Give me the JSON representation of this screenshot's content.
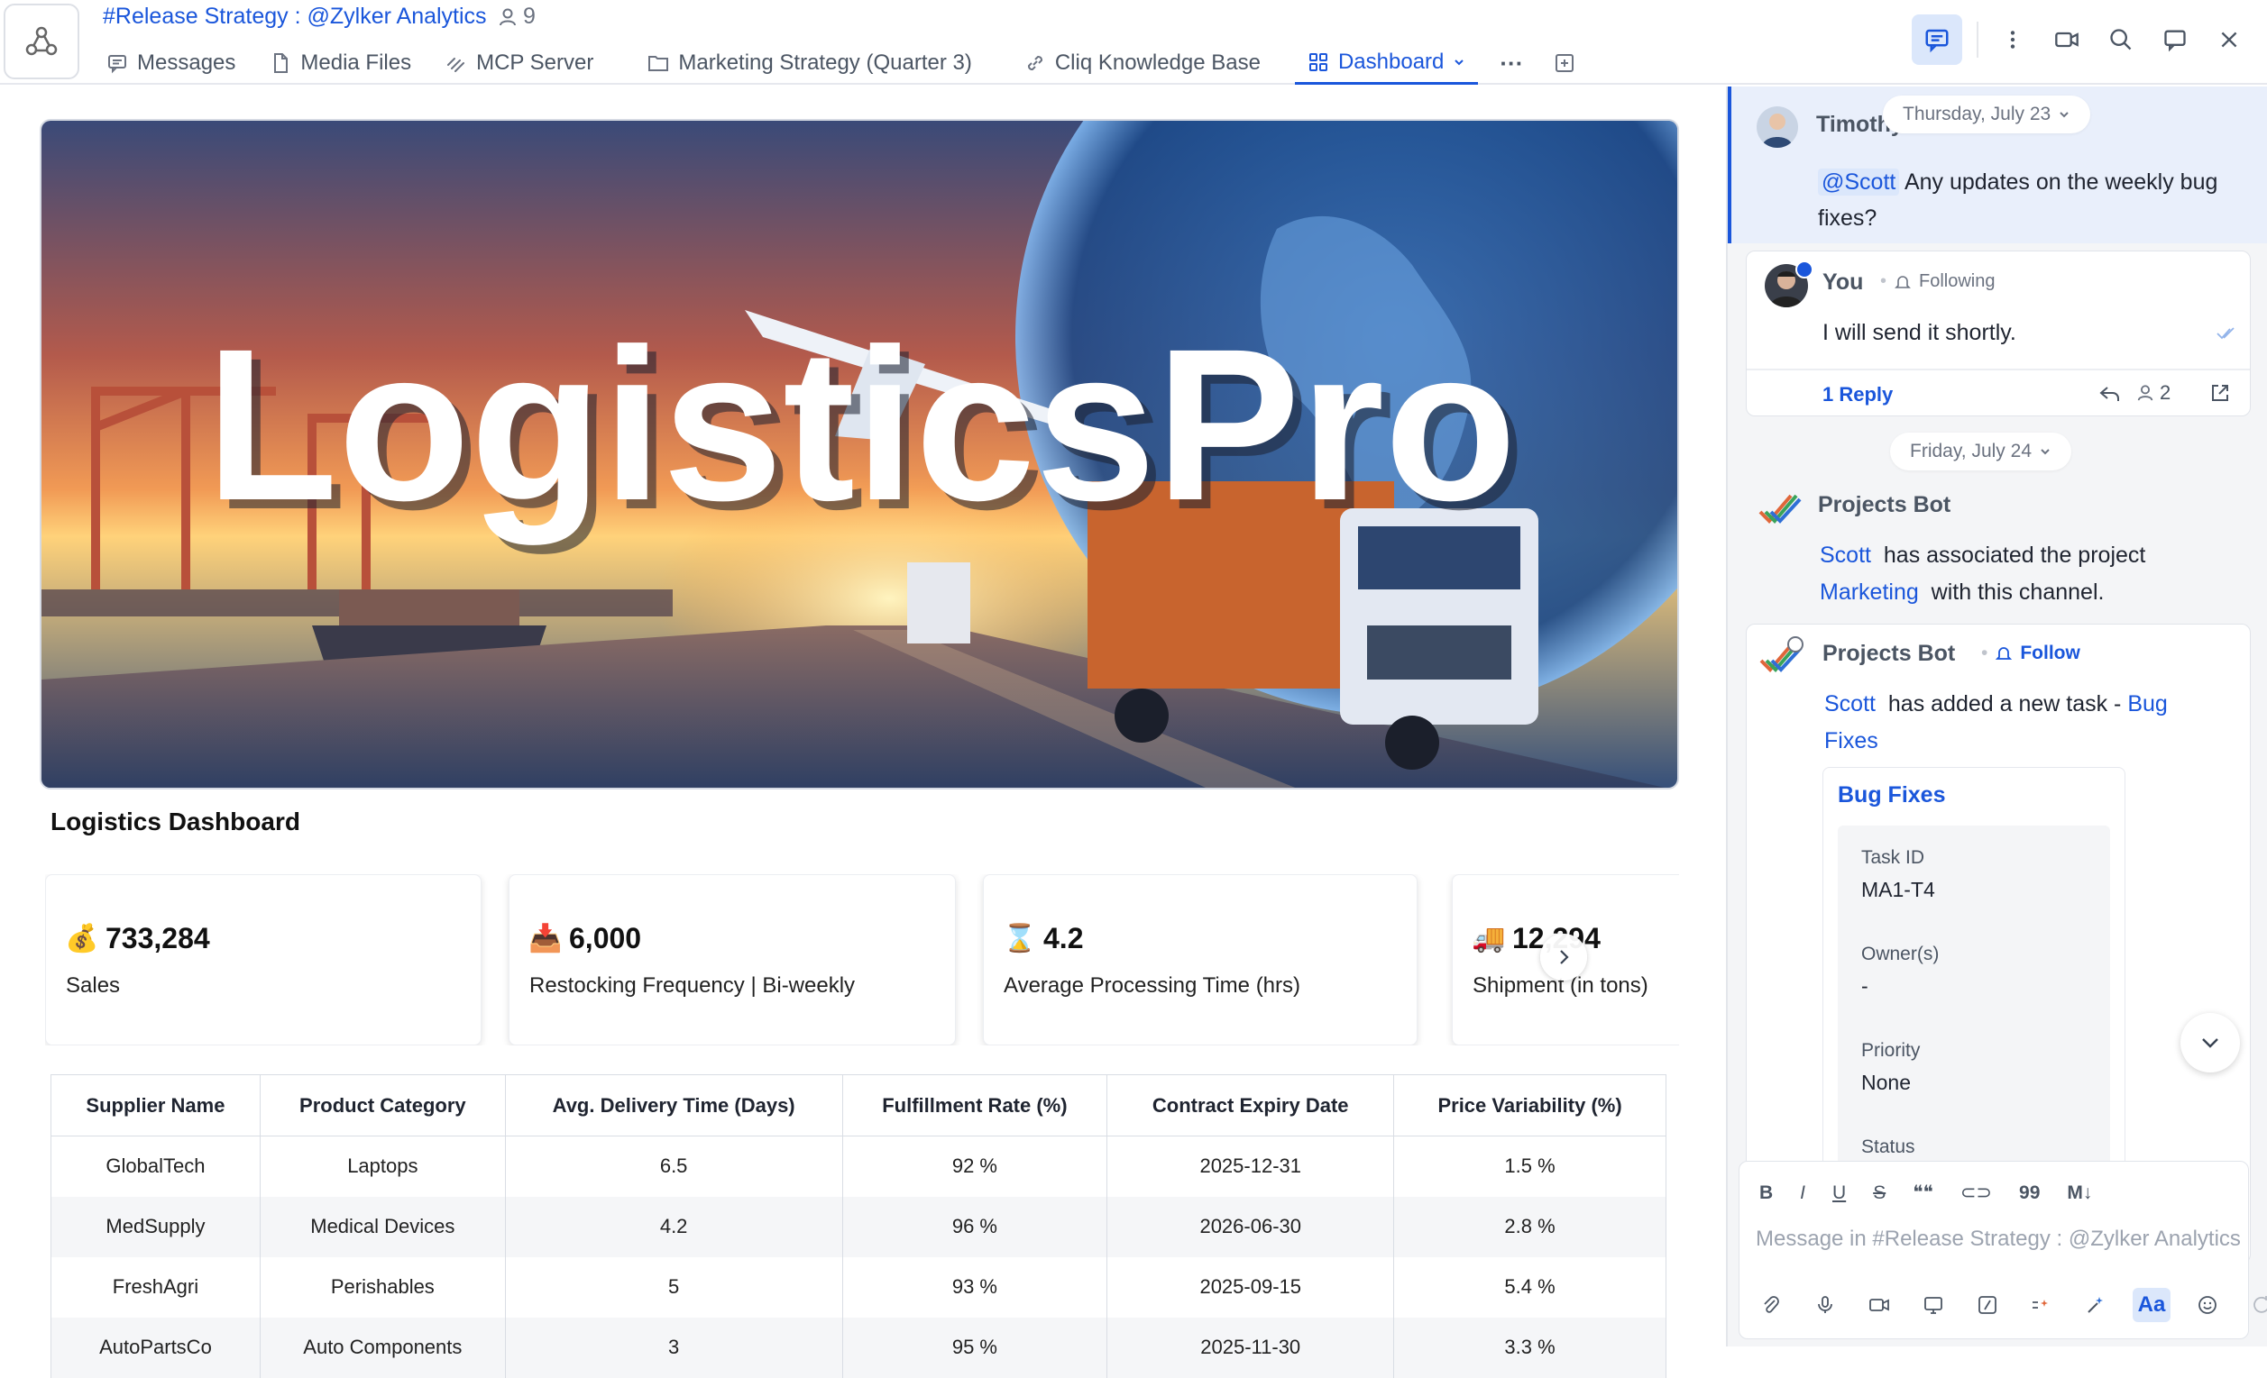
{
  "header": {
    "channel_title": "#Release Strategy : @Zylker Analytics",
    "member_count": "9",
    "tabs": [
      {
        "label": "Messages",
        "icon": "chat-icon"
      },
      {
        "label": "Media Files",
        "icon": "file-icon"
      },
      {
        "label": "MCP Server",
        "icon": "mcp-icon"
      },
      {
        "label": "Marketing Strategy (Quarter 3)",
        "icon": "folder-icon"
      },
      {
        "label": "Cliq Knowledge Base",
        "icon": "link-icon"
      },
      {
        "label": "Dashboard",
        "icon": "grid-icon",
        "active": true
      }
    ],
    "more_label": "···",
    "accent": "#1a56db"
  },
  "dashboard": {
    "banner_text": "LogisticsPro",
    "title": "Logistics Dashboard",
    "kpis": [
      {
        "emoji": "💰",
        "value": "733,284",
        "label": "Sales"
      },
      {
        "emoji": "📥",
        "value": "6,000",
        "label": "Restocking Frequency | Bi-weekly"
      },
      {
        "emoji": "⌛",
        "value": "4.2",
        "label": "Average Processing Time (hrs)"
      },
      {
        "emoji": "🚚",
        "value": "12,294",
        "label": "Shipment (in tons)"
      }
    ],
    "table": {
      "headers": [
        "Supplier Name",
        "Product Category",
        "Avg. Delivery Time (Days)",
        "Fulfillment Rate (%)",
        "Contract Expiry Date",
        "Price Variability (%)"
      ],
      "rows": [
        [
          "GlobalTech",
          "Laptops",
          "6.5",
          "92 %",
          "2025-12-31",
          "1.5 %"
        ],
        [
          "MedSupply",
          "Medical Devices",
          "4.2",
          "96 %",
          "2026-06-30",
          "2.8 %"
        ],
        [
          "FreshAgri",
          "Perishables",
          "5",
          "93 %",
          "2025-09-15",
          "5.4 %"
        ],
        [
          "AutoPartsCo",
          "Auto Components",
          "3",
          "95 %",
          "2025-11-30",
          "3.3 %"
        ]
      ]
    }
  },
  "chat": {
    "date1": "Thursday, July 23",
    "msg1": {
      "sender": "Timothy",
      "mention": "@Scott",
      "text": "Any updates on the weekly bug",
      "text2": "fixes?"
    },
    "reply": {
      "sender": "You",
      "following": "Following",
      "text": "I will send it shortly.",
      "reply_count": "1 Reply",
      "participants": "2"
    },
    "date2": "Friday, July 24",
    "bot1": {
      "sender": "Projects Bot",
      "user": "Scott",
      "text": "has associated the project",
      "project": "Marketing",
      "text2": "with this channel."
    },
    "bot2": {
      "sender": "Projects Bot",
      "follow": "Follow",
      "user": "Scott",
      "text": "has added a new task -",
      "task_link_1": "Bug",
      "task_link_2": "Fixes"
    },
    "task_card": {
      "title": "Bug Fixes",
      "task_id_label": "Task ID",
      "task_id": "MA1-T4",
      "owner_label": "Owner(s)",
      "owner": "-",
      "priority_label": "Priority",
      "priority": "None",
      "status_label": "Status"
    },
    "composer": {
      "placeholder": "Message in #Release Strategy : @Zylker Analytics",
      "format_buttons": [
        "B",
        "I",
        "U",
        "S",
        "❝❝",
        "⊂⊃",
        "99",
        "M↓"
      ],
      "aa_label": "Aa"
    }
  }
}
